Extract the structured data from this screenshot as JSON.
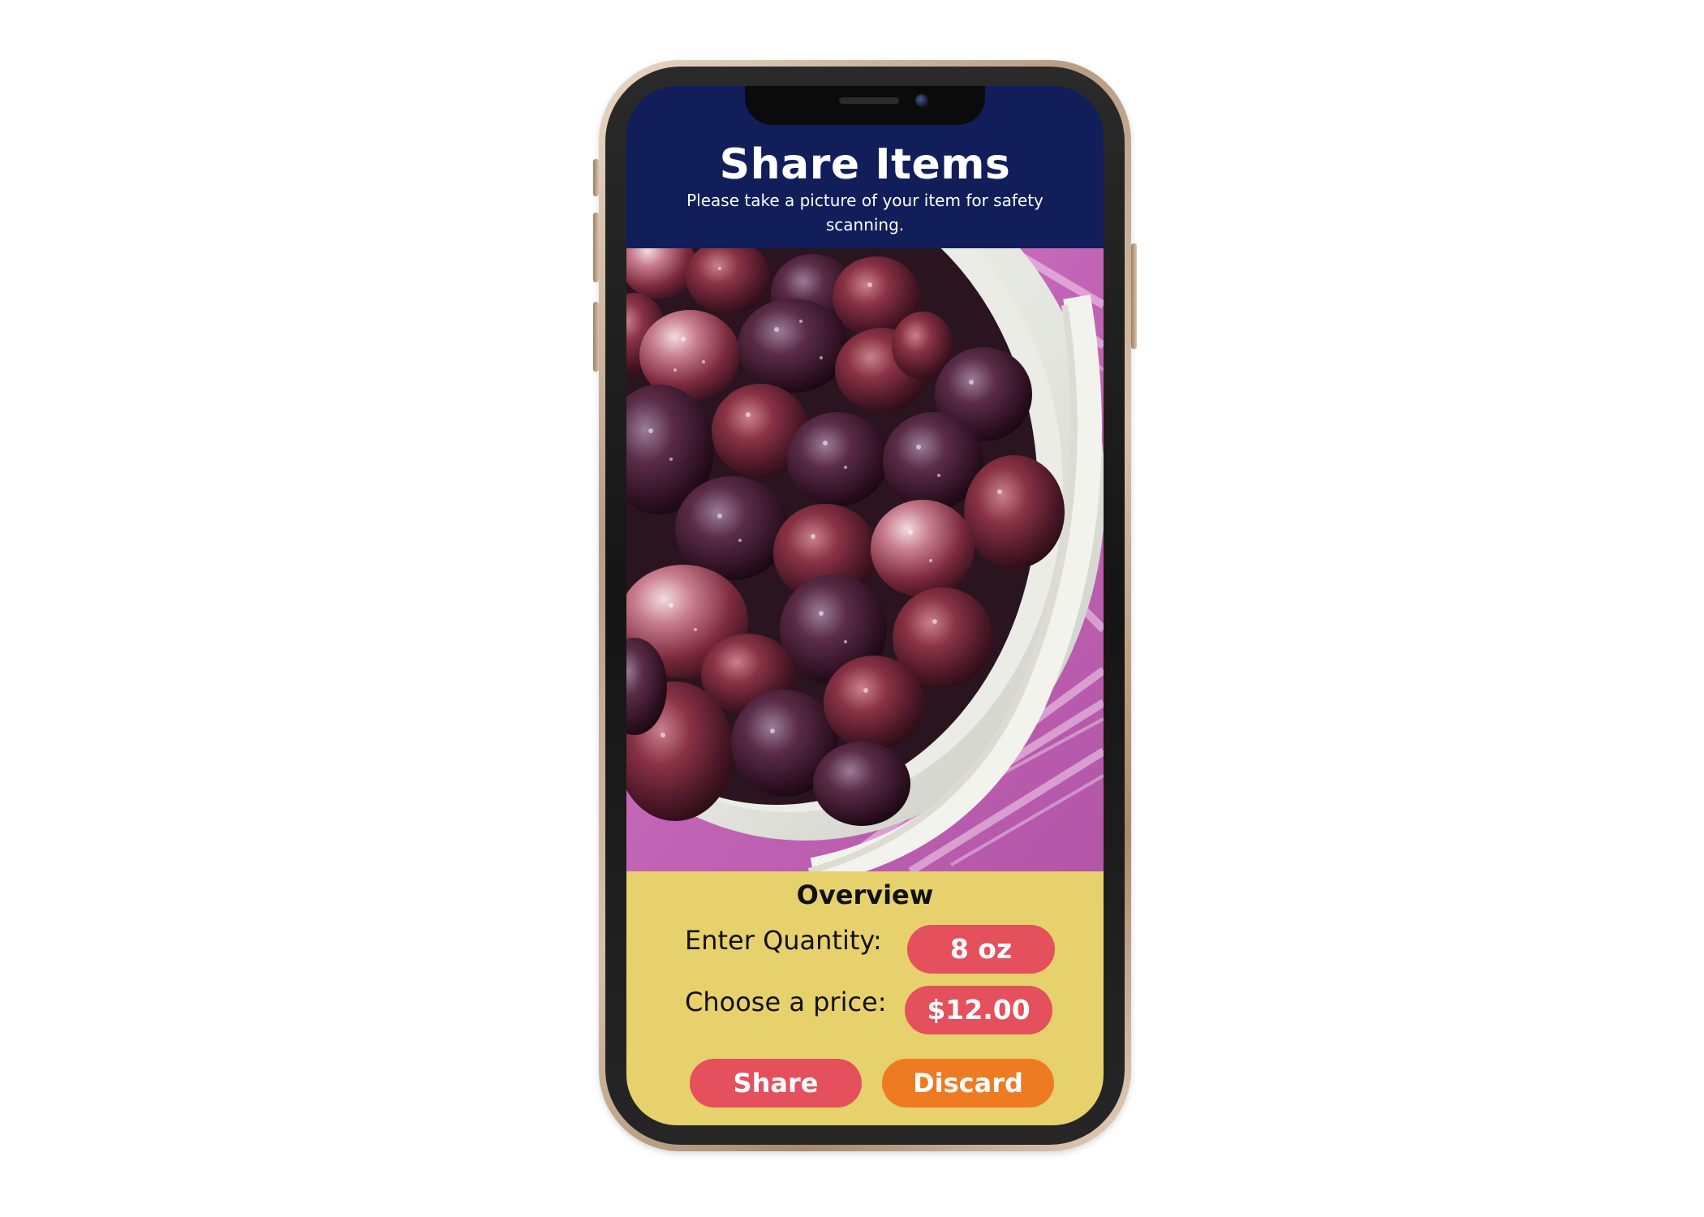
{
  "header": {
    "title": "Share Items",
    "subtitle": "Please take a picture of your item for safety scanning."
  },
  "photo": {
    "subject": "item-photo"
  },
  "overview": {
    "title": "Overview",
    "quantity_label": "Enter Quantity:",
    "quantity_value": "8 oz",
    "price_label": "Choose a price:",
    "price_value": "$12.00"
  },
  "actions": {
    "share_label": "Share",
    "discard_label": "Discard"
  },
  "colors": {
    "header_bg": "#121e5a",
    "overview_bg": "#e6d16d",
    "accent_red": "#e4505c",
    "accent_orange": "#ee7b22"
  }
}
